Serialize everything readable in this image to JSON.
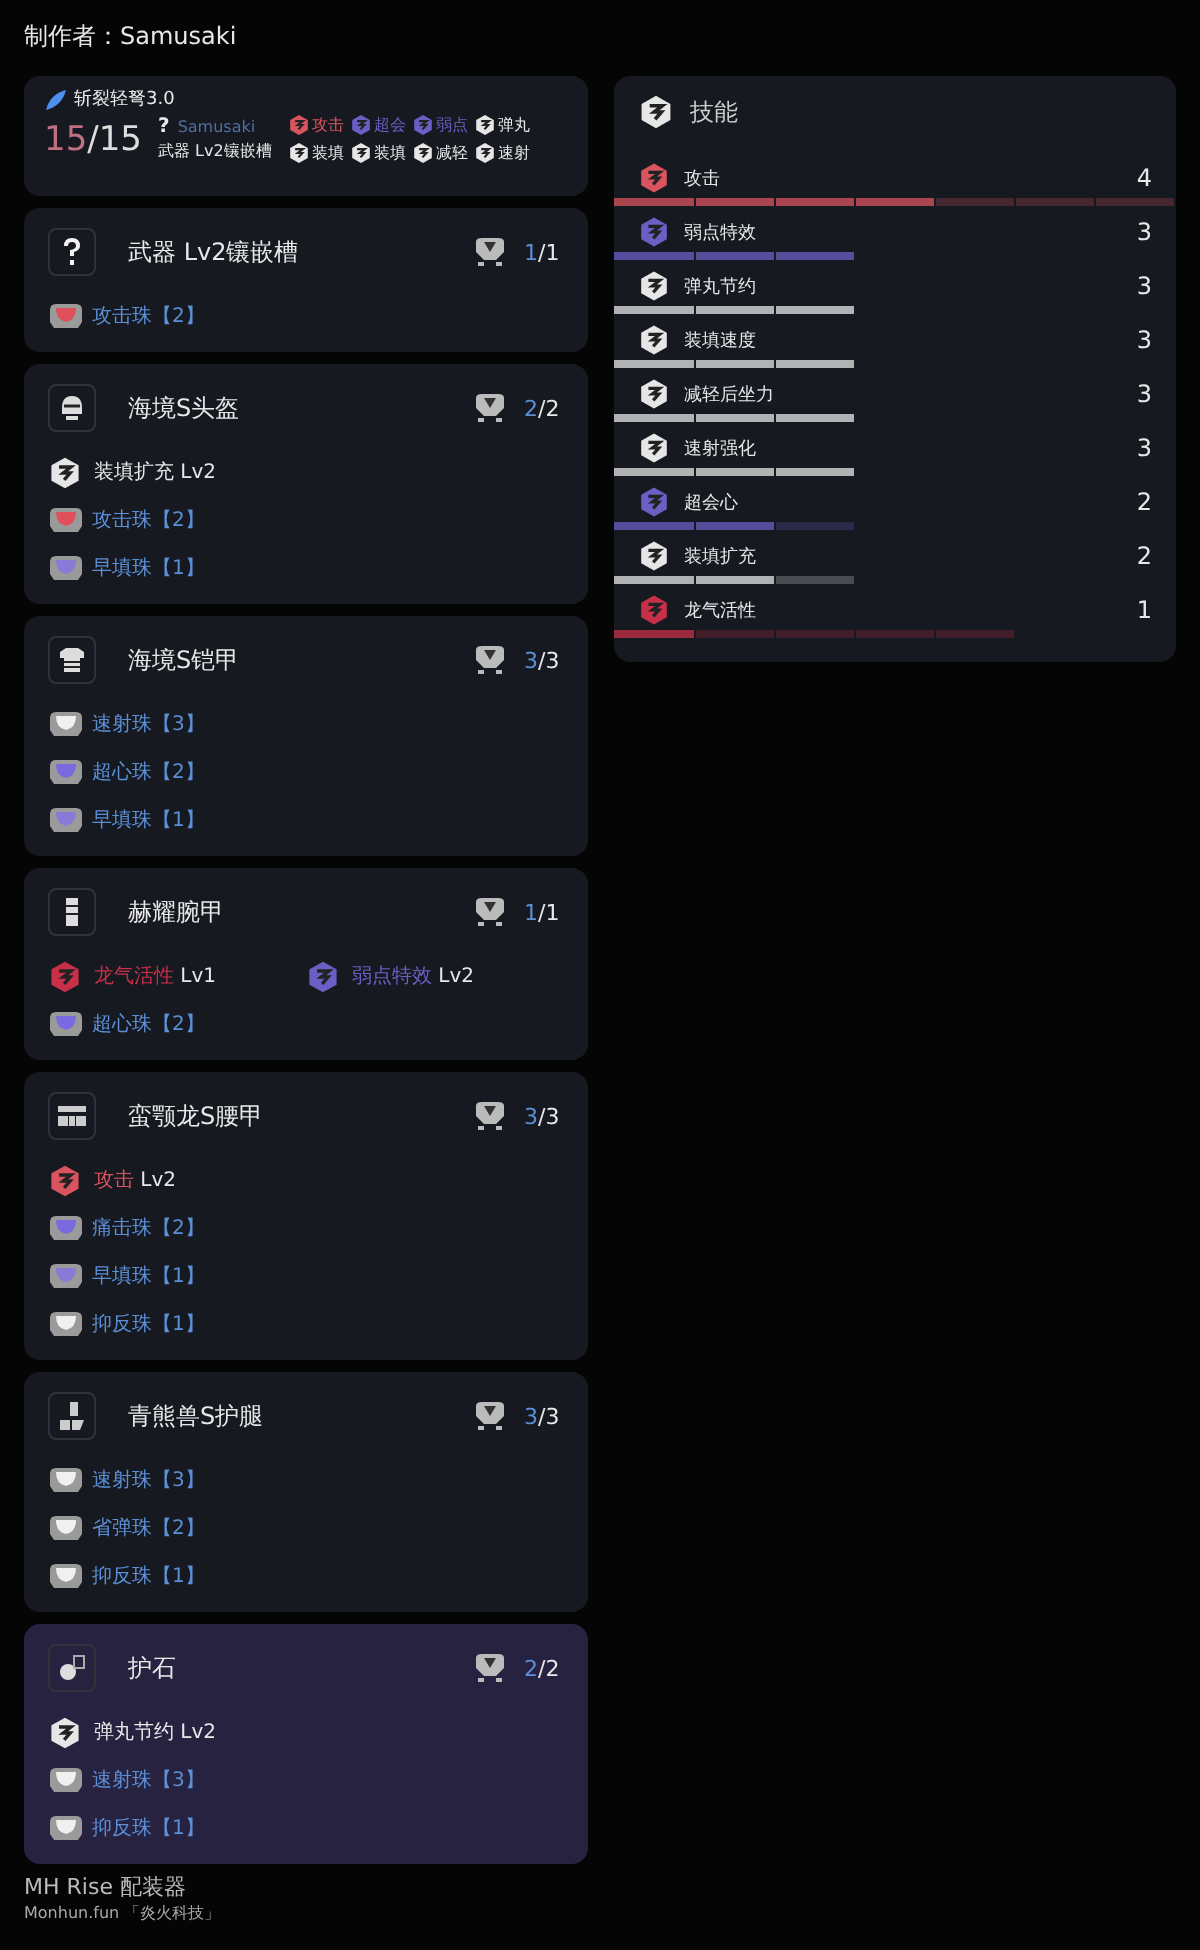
{
  "author": "制作者：Samusaki",
  "summary": {
    "weapon": "斩裂轻弩3.0",
    "slots": "15/15",
    "slot_icon": "?",
    "builder": "Samusaki",
    "weapon_slot": "武器 Lv2镶嵌槽",
    "tags": [
      {
        "label": "攻击",
        "color": "#d9545e"
      },
      {
        "label": "超会",
        "color": "#6a5fc4"
      },
      {
        "label": "弱点",
        "color": "#6a5fc4"
      },
      {
        "label": "弹丸",
        "color": "#e6e6e6"
      },
      {
        "label": "装填",
        "color": "#e6e6e6"
      },
      {
        "label": "装填",
        "color": "#e6e6e6"
      },
      {
        "label": "减轻",
        "color": "#e6e6e6"
      },
      {
        "label": "速射",
        "color": "#e6e6e6"
      }
    ]
  },
  "equipment": [
    {
      "kind": "weapon",
      "name": "武器 Lv2镶嵌槽",
      "slots": "1/1",
      "selected": false,
      "jewels": [
        {
          "name": "攻击珠【2】",
          "color": "#e0505a"
        }
      ]
    },
    {
      "kind": "head",
      "name": "海境S头盔",
      "slots": "2/2",
      "selected": false,
      "skills": [
        {
          "name": "装填扩充",
          "level": "Lv2",
          "color": "#e6e6e6"
        }
      ],
      "jewels": [
        {
          "name": "攻击珠【2】",
          "color": "#e0505a"
        },
        {
          "name": "早填珠【1】",
          "color": "#8a7ad8"
        }
      ]
    },
    {
      "kind": "chest",
      "name": "海境S铠甲",
      "slots": "3/3",
      "selected": false,
      "jewels": [
        {
          "name": "速射珠【3】",
          "color": "#f0f0f0"
        },
        {
          "name": "超心珠【2】",
          "color": "#7a6ae0"
        },
        {
          "name": "早填珠【1】",
          "color": "#8a7ad8"
        }
      ]
    },
    {
      "kind": "arms",
      "name": "赫耀腕甲",
      "slots": "1/1",
      "selected": false,
      "skills": [
        {
          "name": "龙气活性",
          "level": "Lv1",
          "color": "#c8304a"
        },
        {
          "name": "弱点特效",
          "level": "Lv2",
          "color": "#6a5fc4"
        }
      ],
      "jewels": [
        {
          "name": "超心珠【2】",
          "color": "#7a6ae0"
        }
      ]
    },
    {
      "kind": "waist",
      "name": "蛮颚龙S腰甲",
      "slots": "3/3",
      "selected": false,
      "skills": [
        {
          "name": "攻击",
          "level": "Lv2",
          "color": "#d9545e"
        }
      ],
      "jewels": [
        {
          "name": "痛击珠【2】",
          "color": "#7a6ae0"
        },
        {
          "name": "早填珠【1】",
          "color": "#8a7ad8"
        },
        {
          "name": "抑反珠【1】",
          "color": "#f0f0f0"
        }
      ]
    },
    {
      "kind": "legs",
      "name": "青熊兽S护腿",
      "slots": "3/3",
      "selected": false,
      "jewels": [
        {
          "name": "速射珠【3】",
          "color": "#f0f0f0"
        },
        {
          "name": "省弹珠【2】",
          "color": "#f0f0f0"
        },
        {
          "name": "抑反珠【1】",
          "color": "#f0f0f0"
        }
      ]
    },
    {
      "kind": "charm",
      "name": "护石",
      "slots": "2/2",
      "selected": true,
      "skills": [
        {
          "name": "弹丸节约",
          "level": "Lv2",
          "color": "#e6e6e6"
        }
      ],
      "jewels": [
        {
          "name": "速射珠【3】",
          "color": "#f0f0f0"
        },
        {
          "name": "抑反珠【1】",
          "color": "#f0f0f0"
        }
      ]
    }
  ],
  "skills_panel": {
    "title": "技能",
    "skills": [
      {
        "name": "攻击",
        "count": "4",
        "level": 0.5714,
        "color": "#d9545e"
      },
      {
        "name": "弱点特效",
        "count": "3",
        "level": 1,
        "color": "#6a5fc4"
      },
      {
        "name": "弹丸节约",
        "count": "3",
        "level": 1,
        "color": "#e6e6e6"
      },
      {
        "name": "装填速度",
        "count": "3",
        "level": 1,
        "color": "#e6e6e6"
      },
      {
        "name": "减轻后坐力",
        "count": "3",
        "level": 1,
        "color": "#e6e6e6"
      },
      {
        "name": "速射强化",
        "count": "3",
        "level": 1,
        "color": "#e6e6e6"
      },
      {
        "name": "超会心",
        "count": "2",
        "level": 0.6667,
        "color": "#6a5fc4"
      },
      {
        "name": "装填扩充",
        "count": "2",
        "level": 0.6667,
        "color": "#e6e6e6"
      },
      {
        "name": "龙气活性",
        "count": "1",
        "level": 0.2,
        "color": "#c8304a"
      }
    ]
  },
  "footer": {
    "title": "MH Rise 配装器",
    "subtitle": "Monhun.fun 「炎火科技」"
  }
}
